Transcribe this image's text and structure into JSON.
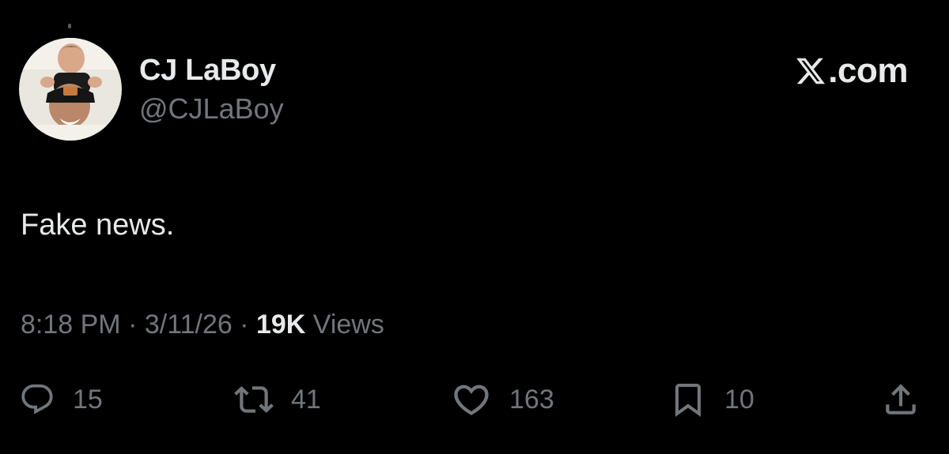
{
  "author": {
    "display_name": "CJ LaBoy",
    "handle": "@CJLaBoy"
  },
  "brand": {
    "logo_icon": "x-logo-icon",
    "label": ".com"
  },
  "tweet": {
    "text": "Fake news."
  },
  "meta": {
    "time": "8:18 PM",
    "separator": " · ",
    "date": "3/11/26",
    "views_count": "19K",
    "views_label": " Views"
  },
  "actions": {
    "reply": {
      "icon": "reply-icon",
      "count": "15"
    },
    "retweet": {
      "icon": "retweet-icon",
      "count": "41"
    },
    "like": {
      "icon": "heart-icon",
      "count": "163"
    },
    "bookmark": {
      "icon": "bookmark-icon",
      "count": "10"
    },
    "share": {
      "icon": "share-icon"
    }
  },
  "colors": {
    "background": "#000000",
    "primary_text": "#e7e9ea",
    "secondary_text": "#71767b"
  }
}
